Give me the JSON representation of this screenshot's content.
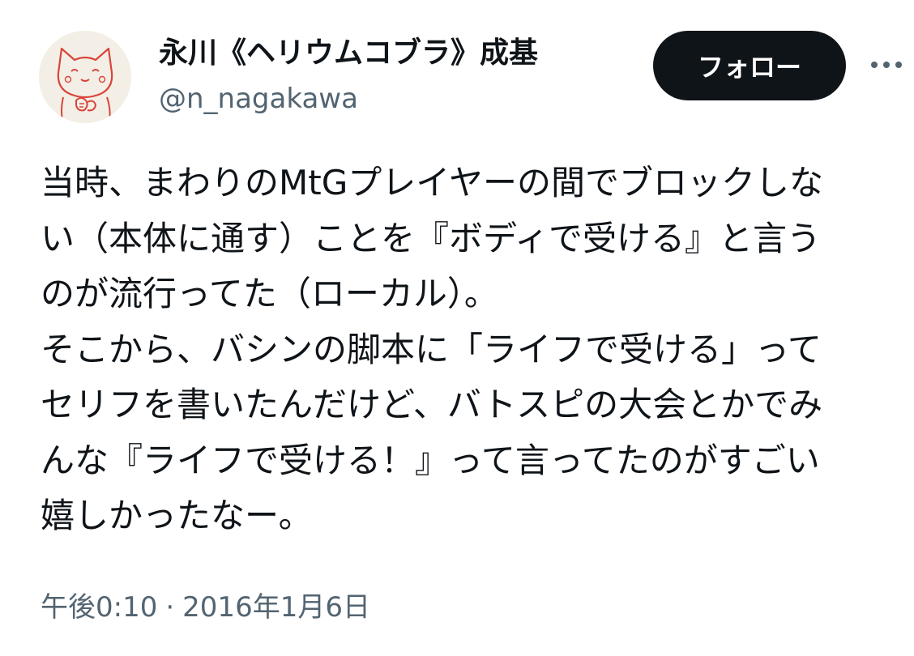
{
  "author": {
    "display_name": "永川《ヘリウムコブラ》成基",
    "handle": "@n_nagakawa",
    "avatar_icon": "cat-illustration-avatar"
  },
  "actions": {
    "follow_label": "フォロー",
    "more_icon": "more-dots-icon"
  },
  "tweet": {
    "lines": [
      "当時、まわりのMtGプレイヤーの間でブロックしな",
      "い（本体に通す）ことを『ボディで受ける』と言う",
      "のが流行ってた（ローカル）。",
      "そこから、バシンの脚本に「ライフで受ける」って",
      "セリフを書いたんだけど、バトスピの大会とかでみ",
      "んな『ライフで受ける！』って言ってたのがすごい",
      "嬉しかったなー。"
    ],
    "time": "午後0:10",
    "separator": "·",
    "date": "2016年1月6日"
  },
  "colors": {
    "text_primary": "#0f1419",
    "text_secondary": "#536471",
    "button_bg": "#0f1419",
    "button_text": "#ffffff",
    "avatar_line": "#d9443a"
  }
}
